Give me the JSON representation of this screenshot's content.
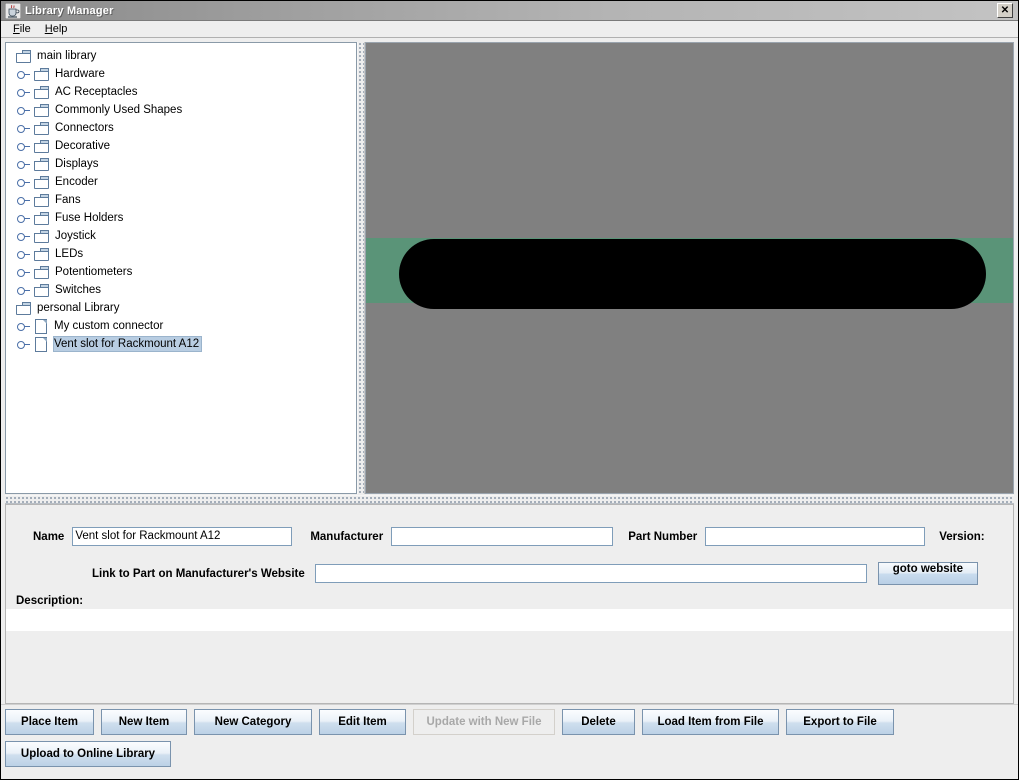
{
  "window": {
    "title": "Library Manager",
    "app_icon": "java-coffee-cup-icon",
    "close_label": "✕"
  },
  "menubar": {
    "items": [
      {
        "label": "File",
        "mnemonic": "F",
        "rest": "ile"
      },
      {
        "label": "Help",
        "mnemonic": "H",
        "rest": "elp"
      }
    ]
  },
  "tree": {
    "nodes": [
      {
        "label": "main library",
        "depth": 0,
        "icon": "folder-icon",
        "expandable": false,
        "selected": false
      },
      {
        "label": "Hardware",
        "depth": 1,
        "icon": "folder-icon",
        "expandable": true,
        "selected": false
      },
      {
        "label": "AC Receptacles",
        "depth": 1,
        "icon": "folder-icon",
        "expandable": true,
        "selected": false
      },
      {
        "label": "Commonly Used Shapes",
        "depth": 1,
        "icon": "folder-icon",
        "expandable": true,
        "selected": false
      },
      {
        "label": "Connectors",
        "depth": 1,
        "icon": "folder-icon",
        "expandable": true,
        "selected": false
      },
      {
        "label": "Decorative",
        "depth": 1,
        "icon": "folder-icon",
        "expandable": true,
        "selected": false
      },
      {
        "label": "Displays",
        "depth": 1,
        "icon": "folder-icon",
        "expandable": true,
        "selected": false
      },
      {
        "label": "Encoder",
        "depth": 1,
        "icon": "folder-icon",
        "expandable": true,
        "selected": false
      },
      {
        "label": "Fans",
        "depth": 1,
        "icon": "folder-icon",
        "expandable": true,
        "selected": false
      },
      {
        "label": "Fuse Holders",
        "depth": 1,
        "icon": "folder-icon",
        "expandable": true,
        "selected": false
      },
      {
        "label": "Joystick",
        "depth": 1,
        "icon": "folder-icon",
        "expandable": true,
        "selected": false
      },
      {
        "label": "LEDs",
        "depth": 1,
        "icon": "folder-icon",
        "expandable": true,
        "selected": false
      },
      {
        "label": "Potentiometers",
        "depth": 1,
        "icon": "folder-icon",
        "expandable": true,
        "selected": false
      },
      {
        "label": "Switches",
        "depth": 1,
        "icon": "folder-icon",
        "expandable": true,
        "selected": false
      },
      {
        "label": "personal Library",
        "depth": 0,
        "icon": "folder-icon",
        "expandable": false,
        "selected": false
      },
      {
        "label": "My custom connector",
        "depth": 1,
        "icon": "document-icon",
        "expandable": true,
        "selected": false
      },
      {
        "label": "Vent slot for Rackmount A12",
        "depth": 1,
        "icon": "document-icon",
        "expandable": true,
        "selected": true
      }
    ]
  },
  "preview": {
    "background_color": "#808080",
    "band_color": "#5a9478",
    "shape_color": "#000000",
    "shape": "rounded-slot"
  },
  "details": {
    "name_label": "Name",
    "name_value": "Vent slot for Rackmount A12",
    "name_placeholder": "",
    "manufacturer_label": "Manufacturer",
    "manufacturer_value": "",
    "manufacturer_placeholder": "",
    "part_number_label": "Part Number",
    "part_number_value": "",
    "part_number_placeholder": "",
    "version_label": "Version:",
    "link_label": "Link to Part on Manufacturer's Website",
    "link_value": "",
    "link_placeholder": "",
    "goto_website_label": "goto website",
    "description_label": "Description:",
    "description_value": ""
  },
  "buttons": {
    "row1": [
      {
        "label": "Place Item",
        "width": 89,
        "disabled": false
      },
      {
        "label": "New Item",
        "width": 86,
        "disabled": false
      },
      {
        "label": "New Category",
        "width": 118,
        "disabled": false
      },
      {
        "label": "Edit Item",
        "width": 87,
        "disabled": false
      },
      {
        "label": "Update with New File",
        "width": 142,
        "disabled": true
      },
      {
        "label": "Delete",
        "width": 73,
        "disabled": false
      },
      {
        "label": "Load Item from File",
        "width": 137,
        "disabled": false
      },
      {
        "label": "Export to File",
        "width": 108,
        "disabled": false
      }
    ],
    "row2": [
      {
        "label": "Upload to Online Library",
        "width": 166,
        "disabled": false
      }
    ]
  }
}
